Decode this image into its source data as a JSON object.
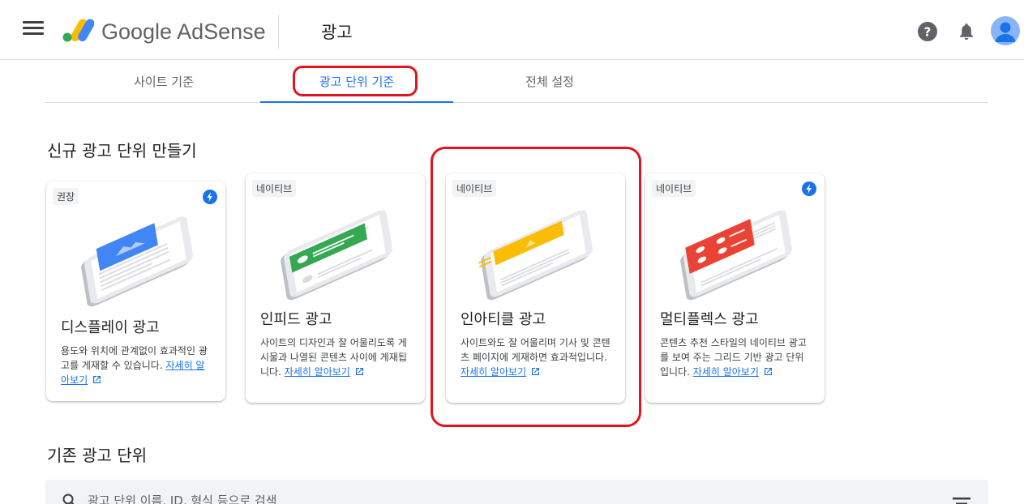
{
  "header": {
    "product_name": "Google AdSense",
    "page_title": "광고",
    "icons": [
      "menu-icon",
      "help-icon",
      "notifications-icon",
      "account-avatar"
    ]
  },
  "tabs": [
    {
      "label": "사이트 기준",
      "active": false
    },
    {
      "label": "광고 단위 기준",
      "active": true
    },
    {
      "label": "전체 설정",
      "active": false
    }
  ],
  "new_section": {
    "title": "신규 광고 단위 만들기"
  },
  "cards": [
    {
      "badge": "권장",
      "title": "디스플레이 광고",
      "desc": "용도와 위치에 관계없이 효과적인 광고를 게재할 수 있습니다.",
      "link": "자세히 알아보기",
      "fast": true,
      "color": "#4285f4"
    },
    {
      "badge": "네이티브",
      "title": "인피드 광고",
      "desc": "사이트의 디자인과 잘 어울리도록 게시물과 나열된 콘텐츠 사이에 게재됩니다.",
      "link": "자세히 알아보기",
      "fast": false,
      "color": "#34a853"
    },
    {
      "badge": "네이티브",
      "title": "인아티클 광고",
      "desc": "사이트와도 잘 어울리며 기사 및 콘텐츠 페이지에 게재하면 효과적입니다.",
      "link": "자세히 알아보기",
      "fast": false,
      "color": "#fbbc04"
    },
    {
      "badge": "네이티브",
      "title": "멀티플렉스 광고",
      "desc": "콘텐츠 추천 스타일의 네이티브 광고를 보여 주는 그리드 기반 광고 단위입니다.",
      "link": "자세히 알아보기",
      "fast": true,
      "color": "#ea4335"
    }
  ],
  "existing_section": {
    "title": "기존 광고 단위"
  },
  "search": {
    "placeholder": "광고 단위 이름, ID, 형식 등으로 검색"
  },
  "colors": {
    "accent": "#1a73e8",
    "highlight": "#e0151f"
  }
}
